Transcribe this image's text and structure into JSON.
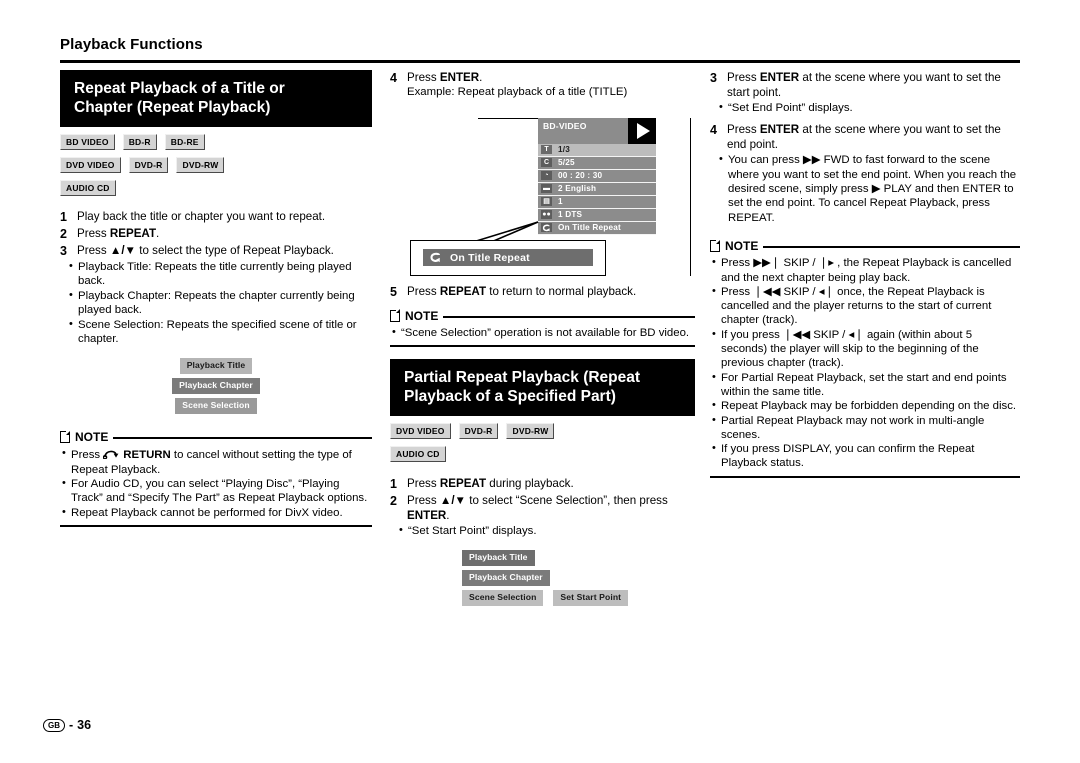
{
  "running_head": "Playback Functions",
  "footer": {
    "region_code": "GB",
    "separator": "-",
    "page_number": "36"
  },
  "left_column": {
    "banner": {
      "line1": "Repeat Playback of a Title or",
      "line2": "Chapter (Repeat Playback)"
    },
    "badges": [
      [
        "BD VIDEO",
        "BD-R",
        "BD-RE"
      ],
      [
        "DVD VIDEO",
        "DVD-R",
        "DVD-RW"
      ],
      [
        "AUDIO CD"
      ]
    ],
    "steps": [
      {
        "num": "1",
        "text": "Play back the title or chapter you want to repeat."
      },
      {
        "num": "2",
        "text_pre": "Press ",
        "bold": "REPEAT",
        "text_post": "."
      },
      {
        "num": "3",
        "text_pre": "Press ",
        "arrows": "▲/▼",
        "text_post": " to select the type of Repeat Playback."
      }
    ],
    "step3_bullets": [
      "Playback Title: Repeats the title currently being played back.",
      "Playback Chapter: Repeats the chapter currently being played back.",
      "Scene Selection: Repeats the specified scene of title or chapter."
    ],
    "chips": [
      "Playback Title",
      "Playback Chapter",
      "Scene Selection"
    ],
    "note": {
      "label": "NOTE",
      "bullets": [
        {
          "pre": "Press ",
          "glyph": "return-icon",
          "bold": "RETURN",
          "post": " to cancel without setting the type of Repeat Playback."
        },
        {
          "pre": "For Audio CD, you can select “Playing Disc”, “Playing Track” and “Specify The Part” as Repeat Playback options."
        },
        {
          "pre": "Repeat Playback cannot be performed for DivX video."
        }
      ]
    }
  },
  "mid_column": {
    "step4": {
      "num": "4",
      "text_pre": "Press ",
      "bold": "ENTER",
      "text_post": "."
    },
    "step4_sub": "Example: Repeat playback of a title (TITLE)",
    "osd": {
      "header_label": "BD-VIDEO",
      "play_icon": "play-icon",
      "rows": [
        {
          "icon": "T",
          "icon_name": "title-icon",
          "text": "1/3",
          "highlight": true
        },
        {
          "icon": "C",
          "icon_name": "chapter-icon",
          "text": "5/25",
          "highlight": false
        },
        {
          "icon": "◔",
          "icon_name": "time-icon",
          "text": "00 : 20 : 30",
          "highlight": false
        },
        {
          "icon": "▬",
          "icon_name": "subtitle-icon",
          "text": "2 English",
          "highlight": false
        },
        {
          "icon": "▤",
          "icon_name": "angle-icon",
          "text": "1",
          "highlight": false
        },
        {
          "icon": "●●",
          "icon_name": "audio-icon",
          "text": "1 DTS",
          "highlight": false
        },
        {
          "icon": "↺",
          "icon_name": "repeat-icon",
          "text": "On Title Repeat",
          "highlight": false
        }
      ]
    },
    "callout": {
      "icon_name": "repeat-icon",
      "text": "On Title Repeat"
    },
    "step5": {
      "num": "5",
      "text_pre": "Press ",
      "bold": "REPEAT",
      "text_post": " to return to normal playback."
    },
    "note": {
      "label": "NOTE",
      "bullets": [
        {
          "pre": "“Scene Selection” operation is not available for BD video."
        }
      ]
    },
    "banner": {
      "line1": "Partial Repeat Playback (Repeat",
      "line2": "Playback of a Specified Part)"
    },
    "badges": [
      [
        "DVD VIDEO",
        "DVD-R",
        "DVD-RW"
      ],
      [
        "AUDIO CD"
      ]
    ],
    "steps": [
      {
        "num": "1",
        "text_pre": "Press ",
        "bold": "REPEAT",
        "text_post": " during playback."
      },
      {
        "num": "2",
        "text_pre": "Press ",
        "arrows": "▲/▼",
        "text_mid": " to select “Scene Selection”, then press ",
        "bold": "ENTER",
        "text_post": "."
      }
    ],
    "step2_bullets": [
      "“Set Start Point” displays."
    ],
    "chips": [
      "Playback Title",
      "Playback Chapter",
      "Scene Selection",
      "Set Start Point"
    ]
  },
  "right_column": {
    "steps": [
      {
        "num": "3",
        "text_pre": "Press ",
        "bold": "ENTER",
        "text_post": " at the scene where you want to set the start point.",
        "bullets": [
          "“Set End Point” displays."
        ]
      },
      {
        "num": "4",
        "text_pre": "Press ",
        "bold": "ENTER",
        "text_post": " at the scene where you want to set the end point.",
        "bullets": [
          "You can press ▶▶ FWD to fast forward to the scene where you want to set the end point. When you reach the desired scene, simply press ▶ PLAY and then ENTER to set the end point. To cancel Repeat Playback, press REPEAT."
        ]
      }
    ],
    "note": {
      "label": "NOTE",
      "bullets": [
        "Press ▶▶❘ SKIP / ❘▸ , the Repeat Playback is cancelled and the next chapter being play back.",
        "Press ❘◀◀ SKIP / ◂❘ once, the Repeat Playback is cancelled and the player returns to the start of current chapter (track).",
        "If you press ❘◀◀ SKIP / ◂❘ again (within about 5 seconds) the player will skip to the beginning of the previous chapter (track).",
        "For Partial Repeat Playback, set the start and end points within the same title.",
        "Repeat Playback may be forbidden depending on the disc.",
        "Partial Repeat Playback may not work in multi-angle scenes.",
        "If you press DISPLAY, you can confirm the Repeat Playback status."
      ]
    }
  }
}
